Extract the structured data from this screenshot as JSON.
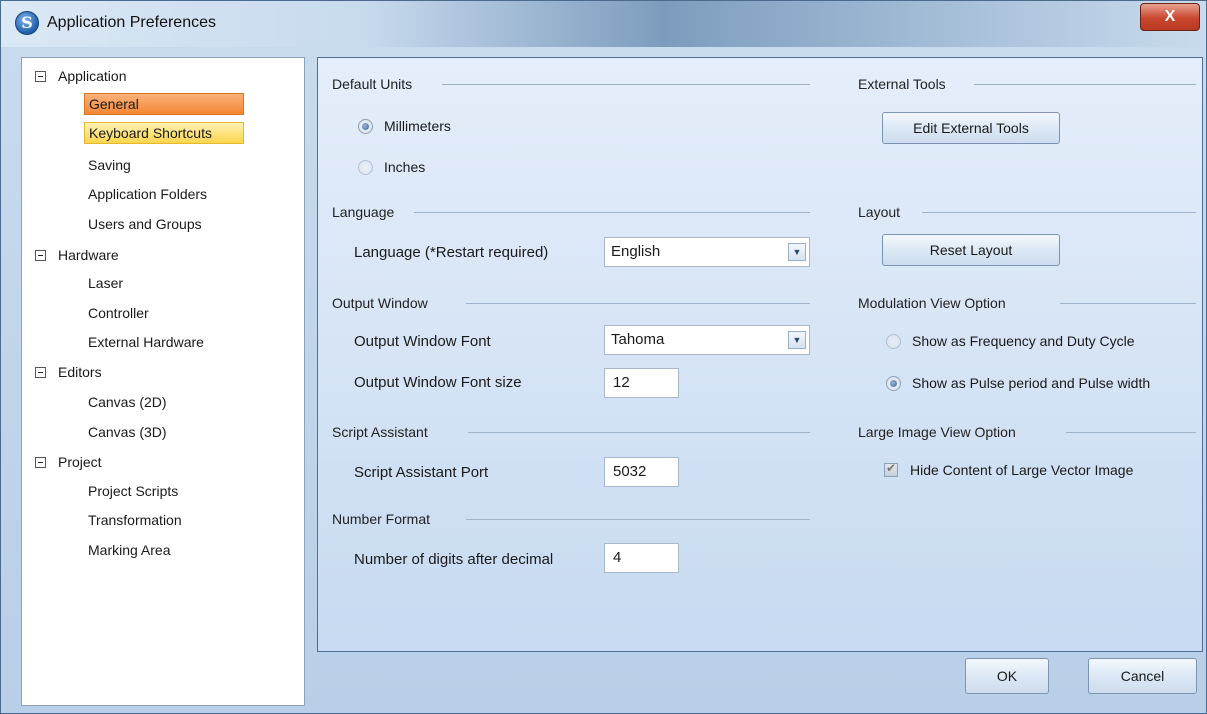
{
  "window": {
    "title": "Application Preferences",
    "app_icon_glyph": "S",
    "close_glyph": "X"
  },
  "tree": {
    "groups": [
      {
        "label": "Application",
        "items": [
          "General",
          "Keyboard Shortcuts",
          "Saving",
          "Application Folders",
          "Users and Groups"
        ]
      },
      {
        "label": "Hardware",
        "items": [
          "Laser",
          "Controller",
          "External Hardware"
        ]
      },
      {
        "label": "Editors",
        "items": [
          "Canvas (2D)",
          "Canvas (3D)"
        ]
      },
      {
        "label": "Project",
        "items": [
          "Project Scripts",
          "Transformation",
          "Marking Area"
        ]
      }
    ],
    "selected": "General",
    "hovered": "Keyboard Shortcuts"
  },
  "default_units": {
    "header": "Default Units",
    "options": [
      "Millimeters",
      "Inches"
    ],
    "selected": "Millimeters"
  },
  "language": {
    "header": "Language",
    "label": "Language (*Restart required)",
    "value": "English"
  },
  "output_window": {
    "header": "Output Window",
    "font_label": "Output Window Font",
    "font_value": "Tahoma",
    "size_label": "Output Window Font size",
    "size_value": "12"
  },
  "script_assistant": {
    "header": "Script Assistant",
    "port_label": "Script Assistant Port",
    "port_value": "5032"
  },
  "number_format": {
    "header": "Number Format",
    "digits_label": "Number of digits after decimal",
    "digits_value": "4"
  },
  "external_tools": {
    "header": "External Tools",
    "button": "Edit External Tools"
  },
  "layout": {
    "header": "Layout",
    "button": "Reset Layout"
  },
  "modulation": {
    "header": "Modulation View Option",
    "options": [
      "Show as Frequency and Duty Cycle",
      "Show as Pulse period and Pulse width"
    ],
    "selected": "Show as Pulse period and Pulse width"
  },
  "large_image": {
    "header": "Large Image View Option",
    "checkbox_label": "Hide Content of Large Vector Image",
    "checked": true
  },
  "footer": {
    "ok": "OK",
    "cancel": "Cancel"
  },
  "colors": {
    "selected_item": "#f58634",
    "hover_item": "#fbd54e",
    "close_button": "#c8462d"
  },
  "icons": {
    "expander": "minus-box-icon",
    "combo_arrow": "chevron-down-icon"
  }
}
